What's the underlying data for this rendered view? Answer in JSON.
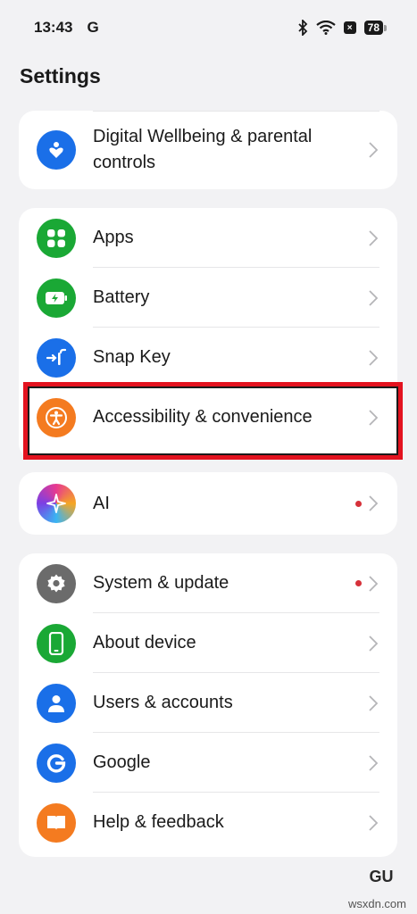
{
  "status_bar": {
    "time": "13:43",
    "carrier_glyph": "G",
    "battery": "78"
  },
  "page_title": "Settings",
  "card1": {
    "items": [
      {
        "label": "Digital Wellbeing & parental controls",
        "icon": "heart-person-icon",
        "color": "#1a6fe8"
      }
    ]
  },
  "card2": {
    "items": [
      {
        "label": "Apps",
        "icon": "grid-icon",
        "color": "#1aa835"
      },
      {
        "label": "Battery",
        "icon": "battery-icon",
        "color": "#1aa835"
      },
      {
        "label": "Snap Key",
        "icon": "snap-key-icon",
        "color": "#1a6fe8"
      },
      {
        "label": "Accessibility & convenience",
        "icon": "accessibility-icon",
        "color": "#f47b20"
      }
    ]
  },
  "card3": {
    "items": [
      {
        "label": "AI",
        "icon": "ai-sparkle-icon",
        "color": "#a13cc8",
        "notification_dot": true
      }
    ]
  },
  "card4": {
    "items": [
      {
        "label": "System & update",
        "icon": "gear-icon",
        "color": "#6b6b6b",
        "notification_dot": true
      },
      {
        "label": "About device",
        "icon": "phone-icon",
        "color": "#1aa835"
      },
      {
        "label": "Users & accounts",
        "icon": "user-icon",
        "color": "#1a6fe8"
      },
      {
        "label": "Google",
        "icon": "google-icon",
        "color": "#1a6fe8"
      },
      {
        "label": "Help & feedback",
        "icon": "book-icon",
        "color": "#f47b20"
      }
    ]
  },
  "watermark": {
    "text": "wsxdn.com"
  }
}
